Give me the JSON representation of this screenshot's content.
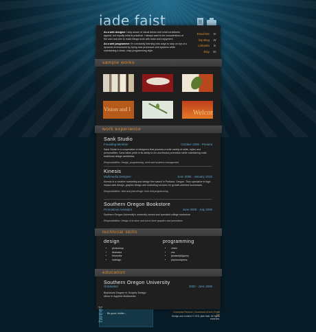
{
  "site_title": "jade faist",
  "intro": {
    "p1_bold": "As a web designer",
    "p1_rest": " I stay aware of visual trends and what constitutes appeal, but equally what is practical. I always want to be conscientious of the user and aim to make things work with ease and enjoyment.",
    "p2_bold": "As a web programmer",
    "p2_rest": " I'm constantly learning new ways to stay on top of a dynamic environment by trying new processes and systems while maintaining a clean, crisp programming style."
  },
  "contacts": [
    {
      "label": "Email Me",
      "icon": "envelope-icon",
      "glyph": "✉"
    },
    {
      "label": "My Blog",
      "icon": "wordpress-icon",
      "glyph": "W"
    },
    {
      "label": "LinkedIn",
      "icon": "linkedin-icon",
      "glyph": "in"
    },
    {
      "label": "Etsy",
      "icon": "etsy-icon",
      "glyph": "Et"
    }
  ],
  "sections": {
    "sample_works": "sample works",
    "work_experience": "work experience",
    "technical_skills": "technical skills",
    "education": "education"
  },
  "thumbs": {
    "t4_text": "Vision and I",
    "t6_text": "Welcom"
  },
  "jobs": [
    {
      "company": "Sank Studio",
      "role": "Founding Member",
      "dates": "October 2006 - Present",
      "desc": "Sank Studio is a cooperative of designers that possess a wide variety of skills, styles and personalities. Sank takes pride in its ability to do unorthodox promotion while maintaining solid, traditional design aesthetics.",
      "resp": "Responsibilities: Design, programming, client and business management"
    },
    {
      "company": "Kinesis",
      "role": "Multimedia Designer",
      "dates": "June 2006 - January 2010",
      "desc": "Kinesis is a creative marketing and design firm based in Portland, Oregon. They specialize in high-impact web design, graphic design and marketing services for growth-oriented businesses.",
      "resp": "Responsibilities: Web and print design, front end programming"
    },
    {
      "company": "Southern Oregon Bookstore",
      "role": "Promotions Assistant",
      "dates": "June 2005 - July 2006",
      "desc": "Southern Oregon University's university owned and operated college bookstore.",
      "resp": "Responsibilities: Design of in-store and out-of-store graphics and promotions"
    }
  ],
  "skills": {
    "design_head": "design",
    "design": [
      "photoshop",
      "illustrator",
      "fireworks",
      "indesign"
    ],
    "programming_head": "programming",
    "programming": [
      "xhtml",
      "css",
      "javascript/jquery",
      "php/wordpress"
    ]
  },
  "education": {
    "school": "Southern Oregon University",
    "status": "Graduated",
    "dates": "2002 - June 2006",
    "degree": "Bachelors Degree in Graphic Design",
    "minor": "Minor in Applied Multimedia"
  },
  "tweet": {
    "label": "tweet",
    "text": "Be good, twitter..."
  },
  "footer": {
    "links": "Download Resume | Download vCard | Email Me",
    "copyright": "Design and content © 2011 jade faist. All rights reserved."
  }
}
